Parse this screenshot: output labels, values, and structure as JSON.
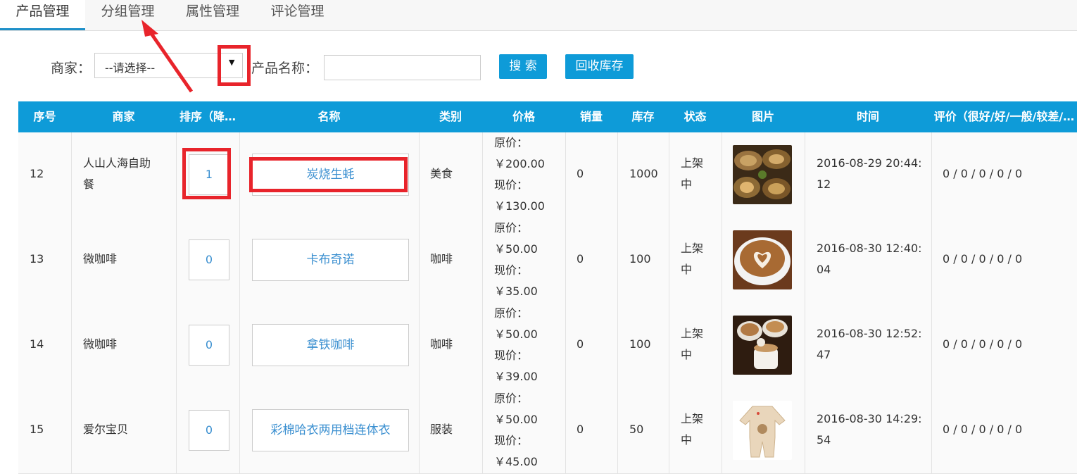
{
  "tabs": [
    "产品管理",
    "分组管理",
    "属性管理",
    "评论管理"
  ],
  "filters": {
    "merchant_label": "商家：",
    "merchant_selected": "--请选择--",
    "product_name_label": "产品名称：",
    "product_name_value": "",
    "search_label": "搜 索",
    "recycle_label": "回收库存"
  },
  "table": {
    "headers": [
      "序号",
      "商家",
      "排序（降…",
      "名称",
      "类别",
      "价格",
      "销量",
      "库存",
      "状态",
      "图片",
      "时间",
      "评价（很好/好/一般/较差/…"
    ],
    "rows": [
      {
        "id": "12",
        "merchant": "人山人海自助\n餐",
        "sort": "1",
        "name": "炭烧生蚝",
        "category": "美食",
        "orig_label": "原价：",
        "orig_price": "￥200.00",
        "now_label": "现价：",
        "now_price": "￥130.00",
        "sales": "0",
        "stock": "1000",
        "status": "上架\n中",
        "image": "oyster-photo",
        "time": "2016-08-29 20:44:\n12",
        "rating": "0 / 0 / 0 / 0 / 0"
      },
      {
        "id": "13",
        "merchant": "微咖啡",
        "sort": "0",
        "name": "卡布奇诺",
        "category": "咖啡",
        "orig_label": "原价：",
        "orig_price": "￥50.00",
        "now_label": "现价：",
        "now_price": "￥35.00",
        "sales": "0",
        "stock": "100",
        "status": "上架\n中",
        "image": "cappuccino-photo",
        "time": "2016-08-30 12:40:\n04",
        "rating": "0 / 0 / 0 / 0 / 0"
      },
      {
        "id": "14",
        "merchant": "微咖啡",
        "sort": "0",
        "name": "拿铁咖啡",
        "category": "咖啡",
        "orig_label": "原价：",
        "orig_price": "￥50.00",
        "now_label": "现价：",
        "now_price": "￥39.00",
        "sales": "0",
        "stock": "100",
        "status": "上架\n中",
        "image": "latte-photo",
        "time": "2016-08-30 12:52:\n47",
        "rating": "0 / 0 / 0 / 0 / 0"
      },
      {
        "id": "15",
        "merchant": "爱尔宝贝",
        "sort": "0",
        "name": "彩棉哈衣两用档连体衣",
        "category": "服装",
        "orig_label": "原价：",
        "orig_price": "￥50.00",
        "now_label": "现价：",
        "now_price": "￥45.00",
        "sales": "0",
        "stock": "50",
        "status": "上架\n中",
        "image": "baby-romper-photo",
        "time": "2016-08-30 14:29:\n54",
        "rating": "0 / 0 / 0 / 0 / 0"
      }
    ]
  },
  "colors": {
    "accent": "#0e9bd8",
    "annotation": "#e8242b",
    "link": "#3a8fd0"
  }
}
